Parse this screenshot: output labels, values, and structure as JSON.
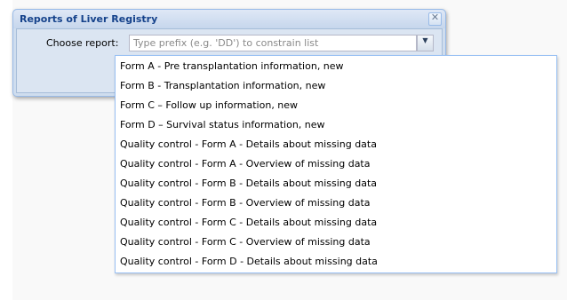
{
  "dialog": {
    "title": "Reports of Liver Registry",
    "close_icon": "close-icon",
    "field_label": "Choose report:",
    "input_placeholder": "Type prefix (e.g. 'DD') to constrain list",
    "trigger_icon": "chevron-down-icon"
  },
  "dropdown": {
    "items": [
      "Form A - Pre transplantation information, new",
      "Form B - Transplantation information, new",
      "Form C – Follow up information, new",
      "Form D – Survival status information, new",
      "Quality control - Form A - Details about missing data",
      "Quality control - Form A - Overview of missing data",
      "Quality control - Form B - Details about missing data",
      "Quality control - Form B - Overview of missing data",
      "Quality control - Form C - Details about missing data",
      "Quality control - Form C - Overview of missing data",
      "Quality control - Form D - Details about missing data"
    ]
  },
  "colors": {
    "title_text": "#15428b",
    "list_border": "#98c0f4",
    "window_border": "#99bbe8"
  }
}
